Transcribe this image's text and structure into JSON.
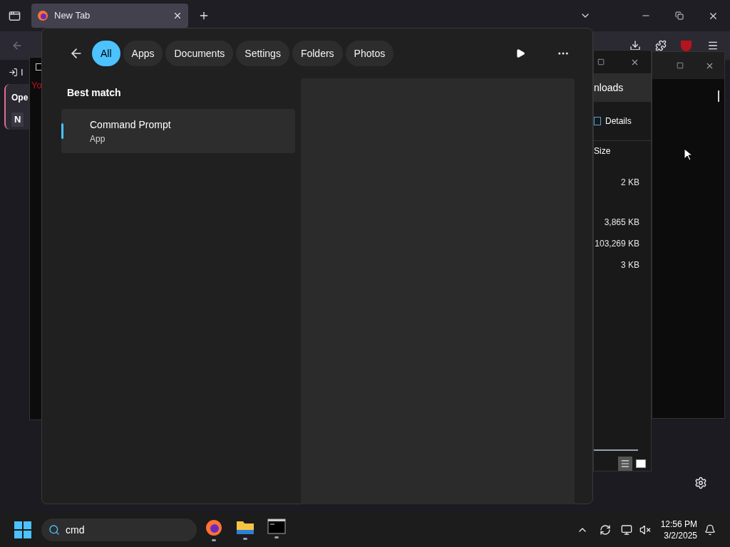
{
  "browser": {
    "tab_title": "New Tab",
    "sidebar_fragments": [
      {
        "kind": "link",
        "text": "I"
      },
      {
        "kind": "heading",
        "text": "Ope"
      },
      {
        "kind": "button",
        "text": "N"
      }
    ]
  },
  "console": {
    "fragment": "Yo"
  },
  "explorer": {
    "location": "nloads",
    "view_label": "Details",
    "column": "Size",
    "sizes": [
      "2 KB",
      "3,865 KB",
      "103,269 KB",
      "3 KB"
    ],
    "views": [
      {
        "kind": "details",
        "selected": true
      },
      {
        "kind": "tiles",
        "selected": false
      }
    ]
  },
  "search": {
    "filters": [
      {
        "label": "All",
        "selected": true
      },
      {
        "label": "Apps",
        "selected": false
      },
      {
        "label": "Documents",
        "selected": false
      },
      {
        "label": "Settings",
        "selected": false
      },
      {
        "label": "Folders",
        "selected": false
      },
      {
        "label": "Photos",
        "selected": false
      }
    ],
    "section": "Best match",
    "results": [
      {
        "name": "Command Prompt",
        "type": "App",
        "selected": true
      }
    ]
  },
  "taskbar": {
    "query": "cmd",
    "apps": [
      {
        "kind": "firefox"
      },
      {
        "kind": "files"
      },
      {
        "kind": "terminal"
      }
    ],
    "time": "12:56 PM",
    "date": "3/2/2025"
  }
}
